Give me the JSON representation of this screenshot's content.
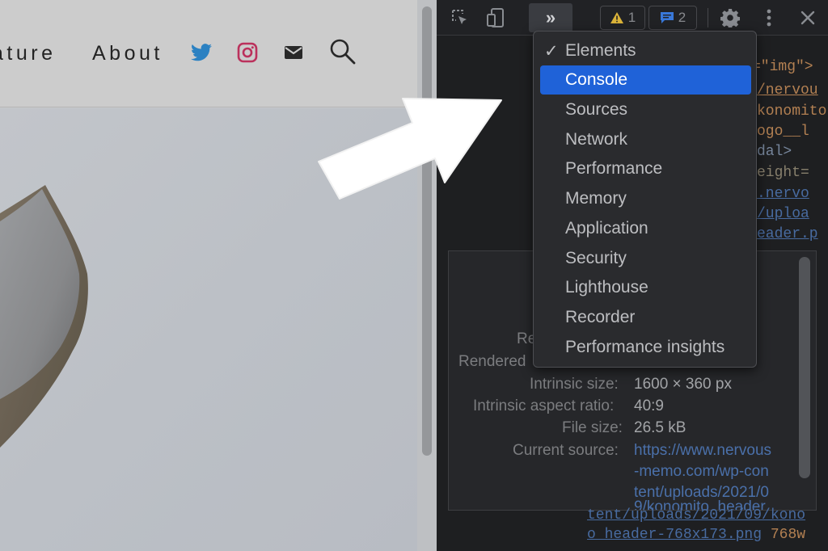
{
  "webpage": {
    "nav": {
      "nature": "ature",
      "about": "About"
    },
    "icons": [
      "twitter-icon",
      "instagram-icon",
      "mail-icon",
      "search-icon"
    ]
  },
  "devtools": {
    "toolbar": {
      "more_tabs": "»",
      "warnings_count": "1",
      "issues_count": "2",
      "icons": [
        "inspect-icon",
        "device-icon",
        "settings-icon",
        "kebab-icon",
        "close-icon"
      ]
    },
    "dom": {
      "line1": "=\"img\">",
      "line2": "/nervou",
      "line3": "konomito",
      "line4": "ogo__l",
      "line5": "dal>",
      "line6": "eight=",
      "line7": ".nervo",
      "line8": "/uploa",
      "line9": "eader.p",
      "bottom1": "tent/uploads/2021/09/kono",
      "bottom2": "o_header-768x173.png",
      "bottom2_suffix": "768w"
    },
    "menu": {
      "items": [
        {
          "label": "Elements",
          "checked": true,
          "active": false
        },
        {
          "label": "Console",
          "checked": false,
          "active": true
        },
        {
          "label": "Sources",
          "checked": false,
          "active": false
        },
        {
          "label": "Network",
          "checked": false,
          "active": false
        },
        {
          "label": "Performance",
          "checked": false,
          "active": false
        },
        {
          "label": "Memory",
          "checked": false,
          "active": false
        },
        {
          "label": "Application",
          "checked": false,
          "active": false
        },
        {
          "label": "Security",
          "checked": false,
          "active": false
        },
        {
          "label": "Lighthouse",
          "checked": false,
          "active": false
        },
        {
          "label": "Recorder",
          "checked": false,
          "active": false
        },
        {
          "label": "Performance insights",
          "checked": false,
          "active": false
        }
      ],
      "checkmark": "✓"
    },
    "info_panel": {
      "partial_key_1": "Re",
      "partial_key_2": "Rendered",
      "intrinsic_size_label": "Intrinsic size:",
      "intrinsic_size_value": "1600 × 360 px",
      "aspect_ratio_label": "Intrinsic aspect ratio:",
      "aspect_ratio_value": "40:9",
      "file_size_label": "File size:",
      "file_size_value": "26.5 kB",
      "current_source_label": "Current source:",
      "current_source_lines": [
        "https://www.nervous",
        "-memo.com/wp-con",
        "tent/uploads/2021/0",
        "9/konomito_header"
      ]
    }
  },
  "colors": {
    "menu_active": "#1f62d8",
    "devtools_bg": "#1f2023",
    "webpage_bg": "#cdcfd2",
    "twitter": "#2d86c9",
    "instagram": "#c2335f",
    "warning": "#e2b93b",
    "issues": "#3b7ce0"
  }
}
